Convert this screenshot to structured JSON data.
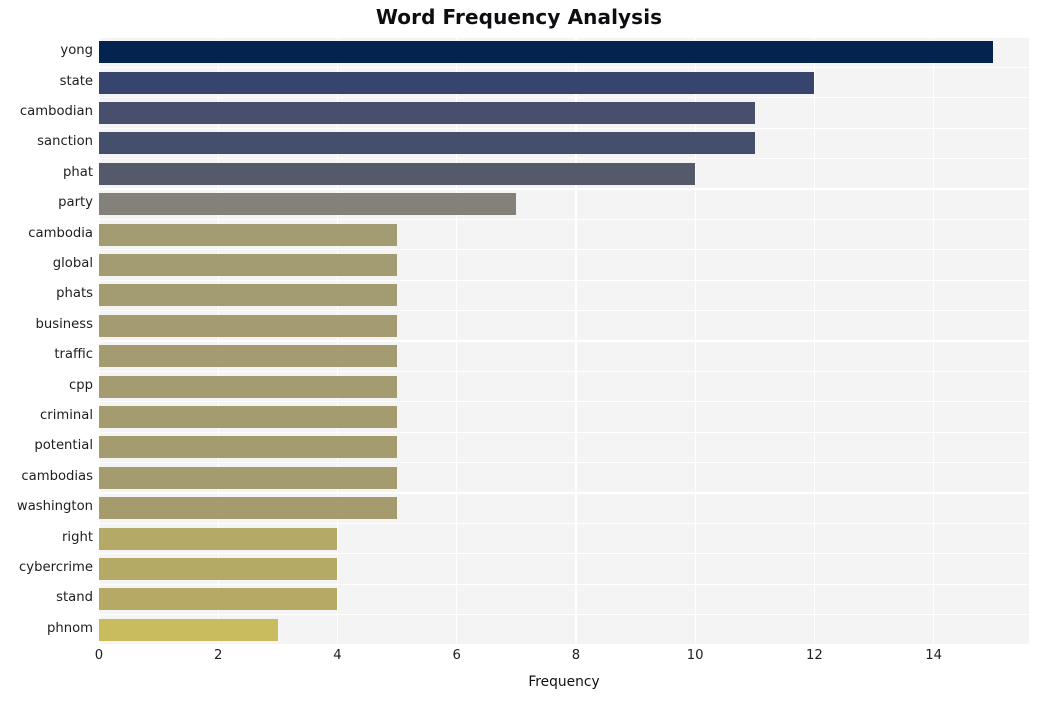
{
  "chart_data": {
    "type": "bar",
    "orientation": "horizontal",
    "title": "Word Frequency Analysis",
    "xlabel": "Frequency",
    "ylabel": "",
    "categories": [
      "yong",
      "state",
      "cambodian",
      "sanction",
      "phat",
      "party",
      "cambodia",
      "global",
      "phats",
      "business",
      "traffic",
      "cpp",
      "criminal",
      "potential",
      "cambodias",
      "washington",
      "right",
      "cybercrime",
      "stand",
      "phnom"
    ],
    "values": [
      15,
      12,
      11,
      11,
      10,
      7,
      5,
      5,
      5,
      5,
      5,
      5,
      5,
      5,
      5,
      5,
      4,
      4,
      4,
      3
    ],
    "bar_colors": [
      "#04244f",
      "#37446e",
      "#474f6d",
      "#454e6b",
      "#555a6b",
      "#83817a",
      "#a39c72",
      "#a39c72",
      "#a39c71",
      "#a49c70",
      "#a49c70",
      "#a49c70",
      "#a49c6f",
      "#a49c6f",
      "#a49b6e",
      "#a59b6d",
      "#b5a967",
      "#b5a966",
      "#b5a965",
      "#c9bc5f"
    ],
    "xlim": [
      0,
      15.6
    ],
    "xticks": [
      0,
      2,
      4,
      6,
      8,
      10,
      12,
      14
    ],
    "xtick_labels": [
      "0",
      "2",
      "4",
      "6",
      "8",
      "10",
      "12",
      "14"
    ],
    "grid": true,
    "grid_color": "#ffffff",
    "plot_background": "#f4f4f5",
    "figure_background": "#ffffff",
    "legend": null,
    "style": "whitegrid"
  }
}
